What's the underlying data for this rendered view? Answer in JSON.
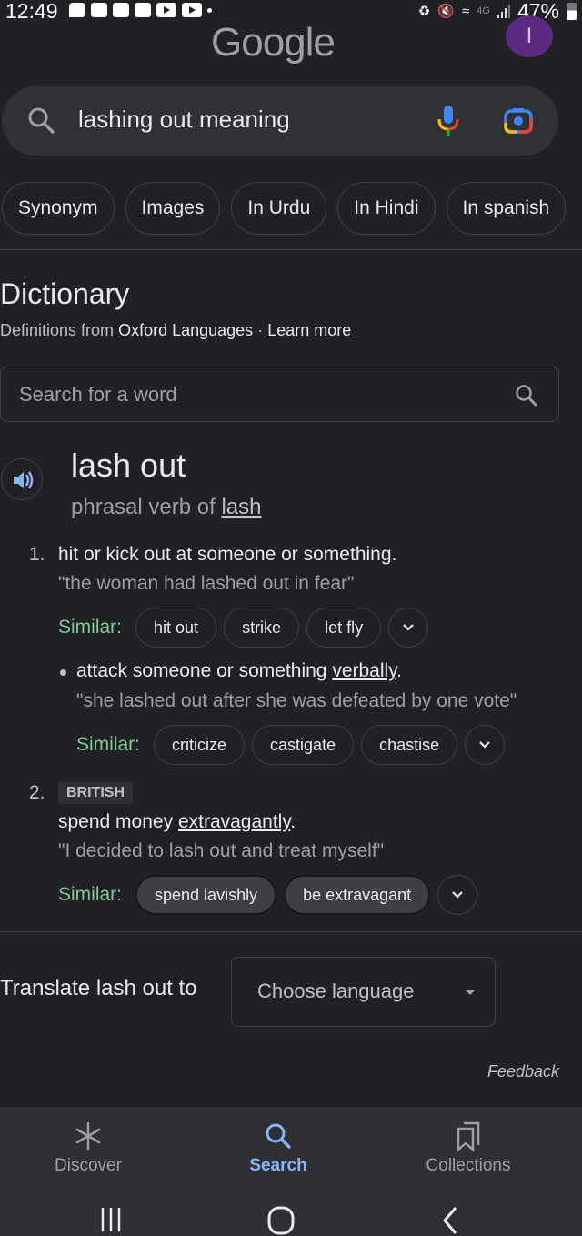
{
  "status_bar": {
    "time": "12:49",
    "notification_icons": [
      "chat-bubble-icon",
      "discord-icon",
      "discord-icon",
      "discord-icon",
      "youtube-icon",
      "youtube-icon"
    ],
    "network": "4G",
    "battery_percent": "47%"
  },
  "header": {
    "logo": "Google",
    "avatar_initial": "I",
    "avatar_color": "#5c2a80"
  },
  "search": {
    "query": "lashing out meaning"
  },
  "chips": [
    "Synonym",
    "Images",
    "In Urdu",
    "In Hindi",
    "In spanish"
  ],
  "dictionary": {
    "title": "Dictionary",
    "source_prefix": "Definitions from",
    "source_link": "Oxford Languages",
    "separator": "·",
    "learn_more": "Learn more",
    "word_search_placeholder": "Search for a word",
    "headword": "lash out",
    "pos_prefix": "phrasal verb of",
    "pos_link": "lash",
    "similar_label": "Similar:",
    "senses": [
      {
        "number": "1.",
        "definition": "hit or kick out at someone or something.",
        "example": "\"the woman had lashed out in fear\"",
        "similar": [
          "hit out",
          "strike",
          "let fly"
        ],
        "subsense": {
          "definition_prefix": "attack someone or something",
          "definition_link": "verbally",
          "definition_suffix": ".",
          "example": "\"she lashed out after she was defeated by one vote\"",
          "similar": [
            "criticize",
            "castigate",
            "chastise"
          ]
        }
      },
      {
        "number": "2.",
        "label": "BRITISH",
        "definition_prefix": "spend money",
        "definition_link": "extravagantly",
        "definition_suffix": ".",
        "example": "\"I decided to lash out and treat myself\"",
        "similar": [
          "spend lavishly",
          "be extravagant"
        ]
      }
    ],
    "translate_label": "Translate lash out to",
    "language_select": "Choose language",
    "feedback": "Feedback"
  },
  "bottom_nav": {
    "items": [
      {
        "label": "Discover",
        "icon": "asterisk-icon",
        "active": false
      },
      {
        "label": "Search",
        "icon": "search-icon",
        "active": true
      },
      {
        "label": "Collections",
        "icon": "collections-icon",
        "active": false
      }
    ]
  },
  "colors": {
    "background": "#202124",
    "accent_blue": "#8ab4f8",
    "similar_green": "#81c995",
    "nav_background": "#2f3033"
  }
}
